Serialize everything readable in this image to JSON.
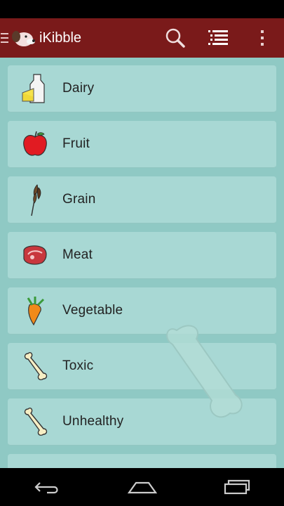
{
  "app": {
    "title": "iKibble"
  },
  "action_bar": {
    "icons": [
      "menu-icon",
      "dog-logo-icon",
      "search-icon",
      "list-view-icon",
      "overflow-menu-icon"
    ]
  },
  "categories": [
    {
      "label": "Dairy",
      "icon": "milk-cheese-icon"
    },
    {
      "label": "Fruit",
      "icon": "apple-icon"
    },
    {
      "label": "Grain",
      "icon": "wheat-icon"
    },
    {
      "label": "Meat",
      "icon": "steak-icon"
    },
    {
      "label": "Vegetable",
      "icon": "carrot-icon"
    },
    {
      "label": "Toxic",
      "icon": "bone-icon"
    },
    {
      "label": "Unhealthy",
      "icon": "bone-icon"
    }
  ],
  "colors": {
    "action_bar": "#7a1a1a",
    "background": "#8fc9c4",
    "card": "#a8d8d4"
  },
  "nav_bar": {
    "icons": [
      "back-icon",
      "home-icon",
      "recent-apps-icon"
    ]
  }
}
